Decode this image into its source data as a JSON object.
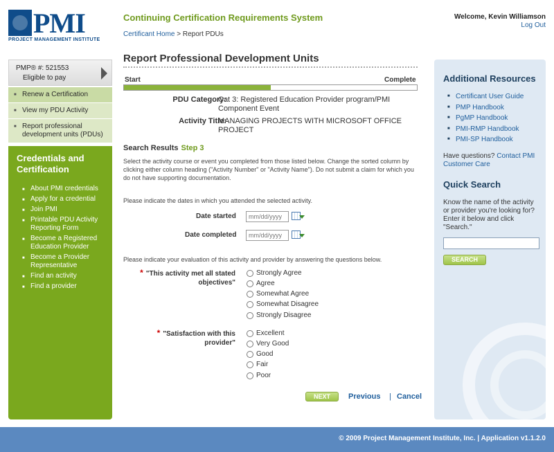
{
  "logo": {
    "letters": "PMI",
    "tagline": "PROJECT MANAGEMENT INSTITUTE"
  },
  "header": {
    "system_title": "Continuing Certification Requirements System",
    "breadcrumb_home": "Certificant Home",
    "breadcrumb_sep": " > ",
    "breadcrumb_current": "Report PDUs",
    "welcome": "Welcome, Kevin Williamson",
    "logout": "Log Out"
  },
  "left": {
    "pmp_id": "PMP® #: 521553",
    "eligibility": "Eligible to pay",
    "nav": [
      {
        "label": "Renew a Certification"
      },
      {
        "label": "View my PDU Activity"
      },
      {
        "label": "Report professional development units (PDUs)"
      }
    ],
    "panel_title": "Credentials and Certification",
    "links": [
      "About PMI credentials",
      "Apply for a credential",
      "Join PMI",
      "Printable PDU Activity Reporting Form",
      "Become a Registered Education Provider",
      "Become a Provider Representative",
      "Find an activity",
      "Find a provider"
    ]
  },
  "main": {
    "heading": "Report Professional Development Units",
    "progress": {
      "start": "Start",
      "complete": "Complete",
      "percent": 50
    },
    "pdu_category_label": "PDU Category:",
    "pdu_category_value": "Cat 3: Registered Education Provider program/PMI Component Event",
    "activity_title_label": "Activity Title:",
    "activity_title_value": "MANAGING PROJECTS WITH MICROSOFT OFFICE PROJECT",
    "results_title": "Search Results",
    "results_step": "Step 3",
    "instructions": "Select the activity course or event you completed from those listed below. Change the sorted column by clicking either column heading (\"Activity Number\" or \"Activity Name\"). Do not submit a claim for which you do not have supporting documentation.",
    "dates_prompt": "Please indicate the dates in which you attended the selected activity.",
    "date_started_label": "Date started",
    "date_completed_label": "Date completed",
    "date_placeholder": "mm/dd/yyyy",
    "eval_prompt": "Please indicate your evaluation of this activity and provider by answering the questions below.",
    "required_mark": "*",
    "q1_label": "\"This activity met all stated objectives\"",
    "q1_options": [
      "Strongly Agree",
      "Agree",
      "Somewhat Agree",
      "Somewhat Disagree",
      "Strongly Disagree"
    ],
    "q2_label": "\"Satisfaction with this provider\"",
    "q2_options": [
      "Excellent",
      "Very Good",
      "Good",
      "Fair",
      "Poor"
    ],
    "next_label": "NEXT",
    "previous_label": "Previous",
    "separator": "|",
    "cancel_label": "Cancel"
  },
  "right": {
    "resources_title": "Additional Resources",
    "resources": [
      "Certificant User Guide",
      "PMP Handbook",
      "PgMP Handbook",
      "PMI-RMP Handbook",
      "PMI-SP Handbook"
    ],
    "questions_text": "Have questions? ",
    "contact_link": "Contact PMI Customer Care",
    "quick_search_title": "Quick Search",
    "quick_search_text": "Know the name of the activity or provider you're looking for? Enter it below and click \"Search.\"",
    "search_button": "SEARCH"
  },
  "footer": {
    "copyright": "© 2009 Project Management Institute, Inc.  |  Application v1.1.2.0"
  },
  "colors": {
    "brand_blue": "#0f4c8a",
    "brand_green": "#7aa81e",
    "link_blue": "#1f5e9c",
    "footer_blue": "#5b89c0",
    "required_red": "#cc0000"
  }
}
